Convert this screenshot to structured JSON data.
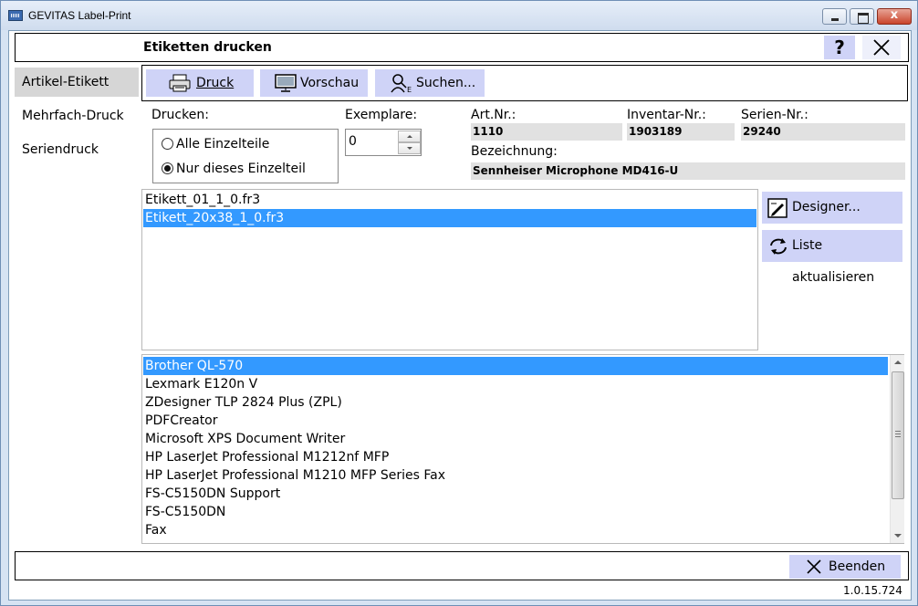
{
  "window": {
    "title": "GEVITAS Label-Print",
    "buttons": {
      "close_glyph": "x"
    }
  },
  "header": {
    "title": "Etiketten drucken",
    "help_label": "?"
  },
  "sidebar": {
    "items": [
      {
        "label": "Artikel-Etikett",
        "active": true
      },
      {
        "label": "Mehrfach-Druck",
        "active": false
      },
      {
        "label": "Seriendruck",
        "active": false
      }
    ]
  },
  "toolbar": {
    "print_label": "Druck",
    "preview_label": "Vorschau",
    "search_label": "Suchen..."
  },
  "print_options": {
    "group_label": "Drucken:",
    "option_all": "Alle Einzelteile",
    "option_single": "Nur dieses Einzelteil",
    "selected": "option_single"
  },
  "copies": {
    "label": "Exemplare:",
    "value": "0"
  },
  "article": {
    "art_nr_label": "Art.Nr.:",
    "art_nr_value": "1110",
    "inventar_label": "Inventar-Nr.:",
    "inventar_value": "1903189",
    "serien_label": "Serien-Nr.:",
    "serien_value": "29240",
    "bezeichnung_label": "Bezeichnung:",
    "bezeichnung_value": "Sennheiser Microphone MD416-U"
  },
  "label_files": {
    "items": [
      "Etikett_01_1_0.fr3",
      "Etikett_20x38_1_0.fr3"
    ],
    "selected_index": 1
  },
  "side_buttons": {
    "designer_label": "Designer...",
    "refresh_label": "Liste aktualisieren"
  },
  "printers": {
    "items": [
      "Brother QL-570",
      "Lexmark E120n V",
      "ZDesigner TLP 2824 Plus (ZPL)",
      "PDFCreator",
      "Microsoft XPS Document Writer",
      "HP LaserJet Professional M1212nf MFP",
      "HP LaserJet Professional M1210 MFP Series Fax",
      "FS-C5150DN Support",
      "FS-C5150DN",
      "Fax"
    ],
    "selected_index": 0
  },
  "footer": {
    "quit_label": "Beenden",
    "version": "1.0.15.724"
  }
}
